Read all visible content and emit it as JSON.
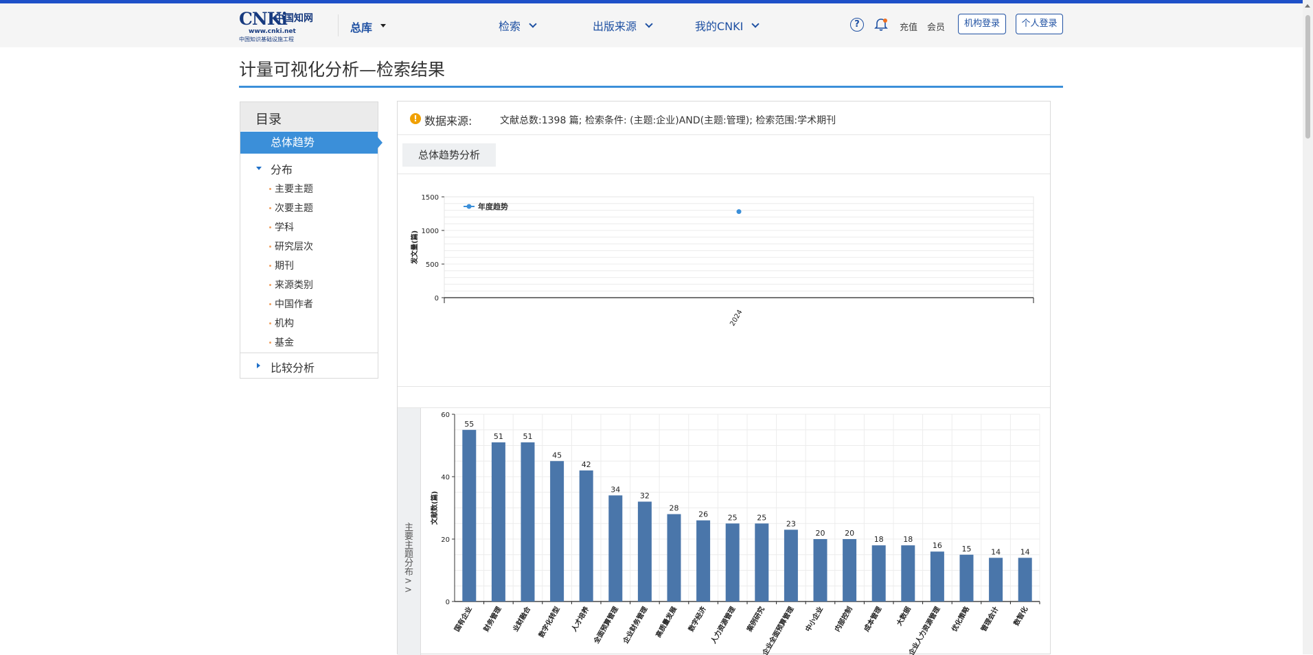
{
  "header": {
    "logo_main": "CNKi",
    "logo_cn": "中国知网",
    "logo_url": "www.cnki.net",
    "logo_sub": "中国知识基础设施工程",
    "db_select": "总库",
    "nav": [
      "检索",
      "出版来源",
      "我的CNKI"
    ],
    "help_icon": "?",
    "recharge": "充值",
    "member": "会员",
    "org_login": "机构登录",
    "personal_login": "个人登录",
    "accent_color": "#1e50a2"
  },
  "page_title": "计量可视化分析—检索结果",
  "sidebar": {
    "title": "目录",
    "active": "总体趋势",
    "group_distribution": "分布",
    "items": [
      "主要主题",
      "次要主题",
      "学科",
      "研究层次",
      "期刊",
      "来源类别",
      "中国作者",
      "机构",
      "基金"
    ],
    "group_compare": "比较分析"
  },
  "info": {
    "label": "数据来源:",
    "text": "文献总数:1398 篇; 检索条件: (主题:企业)AND(主题:管理); 检索范围:学术期刊"
  },
  "trend_tab": "总体趋势分析",
  "side_tab": "主要主题分布 >>",
  "chart_data": [
    {
      "type": "line",
      "legend": "年度趋势",
      "ylabel": "发文量(篇)",
      "x": [
        "2024"
      ],
      "values": [
        1280
      ],
      "ylim": [
        0,
        1500
      ],
      "yticks": [
        0,
        500,
        1000,
        1500
      ],
      "grid": true,
      "legend_position": "top-left",
      "color": "#3b8fd9"
    },
    {
      "type": "bar",
      "ylabel": "文献数(篇)",
      "categories": [
        "国有企业",
        "财务管理",
        "业财融合",
        "数字化转型",
        "人才培养",
        "全面预算管理",
        "企业财务管理",
        "高质量发展",
        "数字经济",
        "人力资源管理",
        "案例研究",
        "企业全面预算管理",
        "中小企业",
        "内部控制",
        "成本管理",
        "大数据",
        "企业人力资源管理",
        "优化策略",
        "管理会计",
        "数智化"
      ],
      "values": [
        55,
        51,
        51,
        45,
        42,
        34,
        32,
        28,
        26,
        25,
        25,
        23,
        20,
        20,
        18,
        18,
        16,
        15,
        14,
        14
      ],
      "ylim": [
        0,
        60
      ],
      "yticks": [
        0,
        20,
        40,
        60
      ],
      "grid": true,
      "color": "#4a76aa"
    }
  ]
}
